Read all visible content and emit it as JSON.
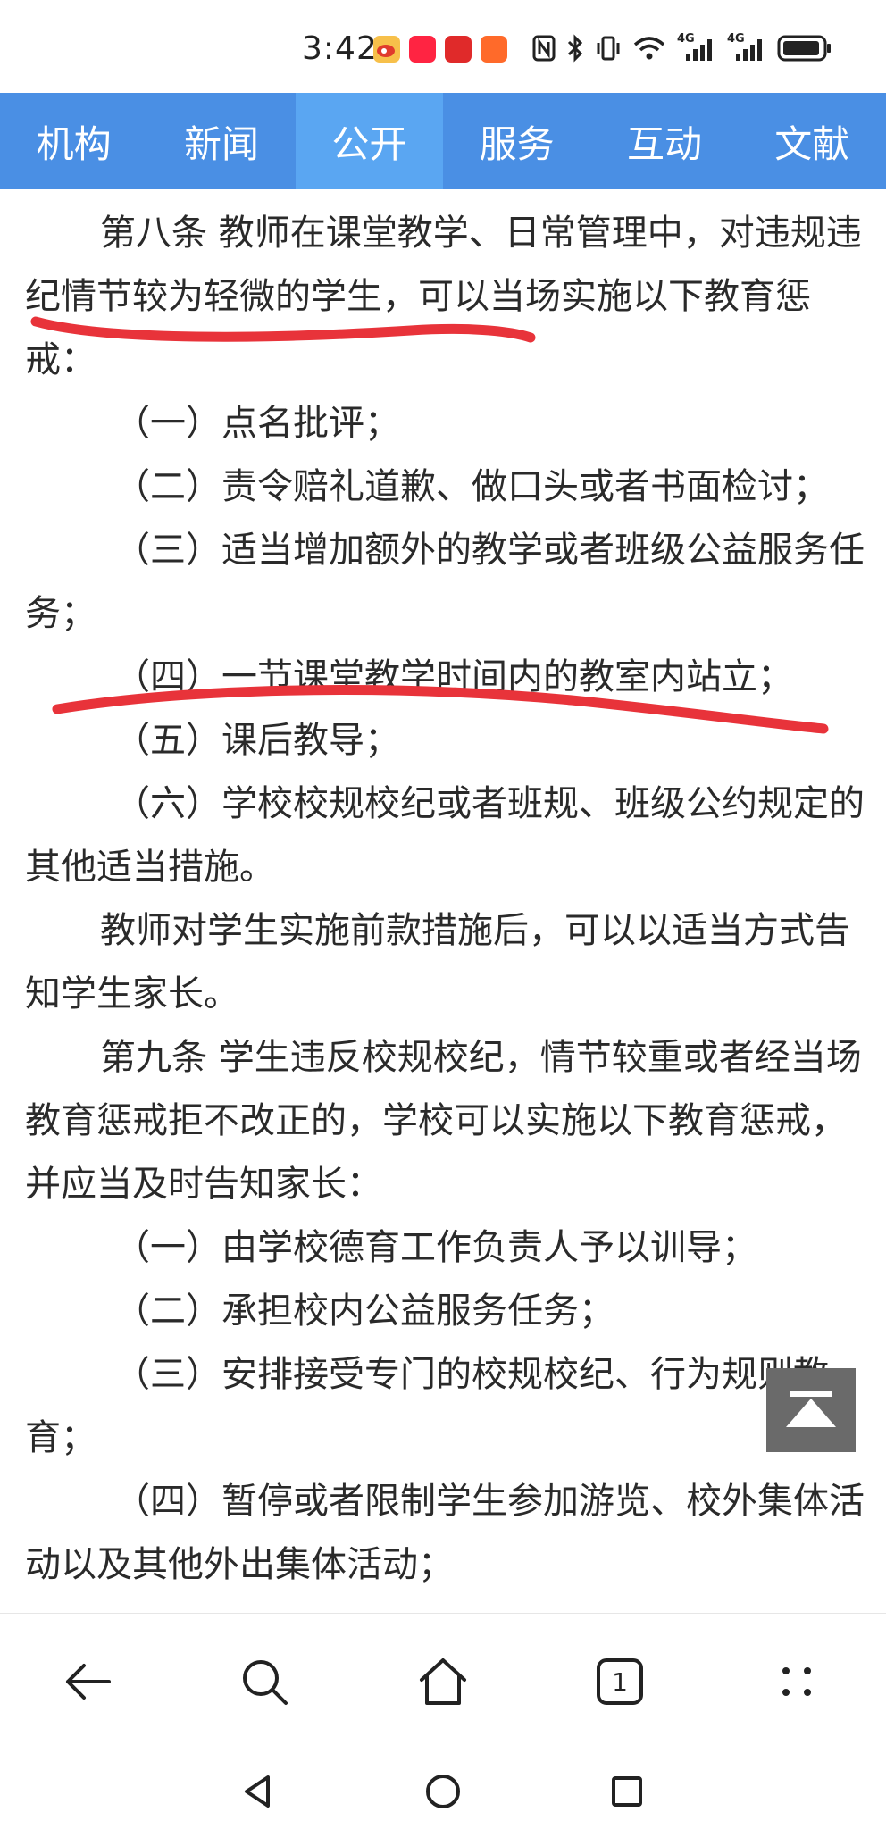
{
  "status_bar": {
    "time": "3:42",
    "network_labels": [
      "4G",
      "4G"
    ],
    "icons": [
      "weibo-icon",
      "xiaohongshu-icon",
      "app-red-icon",
      "app-orange-icon",
      "nfc-icon",
      "bluetooth-icon",
      "vibrate-icon",
      "wifi-icon",
      "signal-4g-icon",
      "signal-4g-icon",
      "battery-icon"
    ]
  },
  "nav": {
    "tabs": [
      {
        "label": "机构",
        "active": false
      },
      {
        "label": "新闻",
        "active": false
      },
      {
        "label": "公开",
        "active": true
      },
      {
        "label": "服务",
        "active": false
      },
      {
        "label": "互动",
        "active": false
      },
      {
        "label": "文献",
        "active": false
      }
    ]
  },
  "article": {
    "art8": "第八条  教师在课堂教学、日常管理中，对违规违纪情节较为轻微的学生，可以当场实施以下教育惩戒：",
    "art8_items": [
      "（一）点名批评；",
      "（二）责令赔礼道歉、做口头或者书面检讨；",
      "（三）适当增加额外的教学或者班级公益服务任务；",
      "（四）一节课堂教学时间内的教室内站立；",
      "（五）课后教导；",
      "（六）学校校规校纪或者班规、班级公约规定的其他适当措施。"
    ],
    "art8_note": "教师对学生实施前款措施后，可以以适当方式告知学生家长。",
    "art9": "第九条  学生违反校规校纪，情节较重或者经当场教育惩戒拒不改正的，学校可以实施以下教育惩戒，并应当及时告知家长：",
    "art9_items": [
      "（一）由学校德育工作负责人予以训导；",
      "（二）承担校内公益服务任务；",
      "（三）安排接受专门的校规校纪、行为规则教育；",
      "（四）暂停或者限制学生参加游览、校外集体活动以及其他外出集体活动；"
    ]
  },
  "annotation_color": "#e8333a",
  "nav_color": "#4a8fe4",
  "toolbar": {
    "icons": [
      "back-arrow-icon",
      "search-icon",
      "home-icon",
      "tabs-icon",
      "more-icon"
    ],
    "tab_count": "1"
  },
  "system_nav": [
    "back-triangle-icon",
    "home-circle-icon",
    "recents-square-icon"
  ]
}
